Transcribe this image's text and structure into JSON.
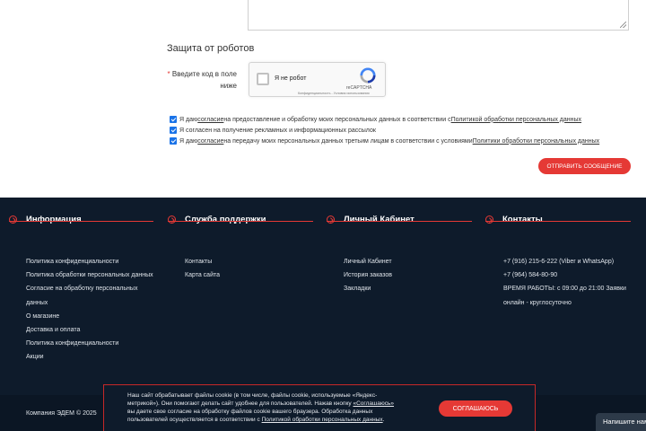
{
  "form": {
    "section_title": "Защита от роботов",
    "captcha_required_mark": "*",
    "captcha_label": "Введите код в поле ниже",
    "recaptcha": {
      "checkbox_label": "Я не робот",
      "brand": "reCAPTCHA",
      "terms": "Конфиденциальность - Условия использования"
    },
    "consents": [
      {
        "checked": true,
        "text_before": "Я даю ",
        "link1": "согласие",
        "text_middle": " на предоставление и обработку моих персональных данных в соответствии с ",
        "link2": "Политикой обработки персональных данных"
      },
      {
        "checked": true,
        "text": "Я согласен на получение рекламных и информационных рассылок"
      },
      {
        "checked": true,
        "text_before": "Я даю ",
        "link1": "согласие",
        "text_middle": " на передачу моих персональных данных третьим лицам в соответствии с условиями ",
        "link2": "Политики обработки персональных данных"
      }
    ],
    "submit_label": "ОТПРАВИТЬ СООБЩЕНИЕ"
  },
  "footer": {
    "columns": [
      {
        "title": "Информация",
        "links": [
          "Политика конфиденциальности",
          "Политика обработки персональных данных",
          "Согласие на обработку персональных",
          "данных",
          "О магазине",
          "Доставка и оплата",
          "Политика конфиденциальности",
          "Акции"
        ]
      },
      {
        "title": "Служба поддержки",
        "links": [
          "Контакты",
          "Карта сайта"
        ]
      },
      {
        "title": "Личный Кабинет",
        "links": [
          "Личный Кабинет",
          "История заказов",
          "Закладки"
        ]
      },
      {
        "title": "Контакты",
        "links": [
          "+7 (916) 215-6-222 (Viber и WhatsApp)",
          "+7 (964) 584-80-90",
          "ВРЕМЯ РАБОТЫ: с 09:00 до 21:00 Заявки",
          "онлайн - круглосуточно"
        ]
      }
    ],
    "copyright": "Компания ЭДЕМ © 2025"
  },
  "cookie": {
    "line1": "Наш сайт обрабатывает файлы cookie (в том числе, файлы cookie, используемые «Яндекс-",
    "line2_before": "метрикой»). Они помогают делать сайт удобнее для пользователей. Нажав кнопку ",
    "line2_link": "«Соглашаюсь»",
    "line3": "вы даете свое согласие на обработку файлов cookie вашего браузера. Обработка данных",
    "line4_before": "пользователей осуществляется в соответствии с ",
    "line4_link": "Политикой обработки персональных данных",
    "line4_after": ".",
    "button": "СОГЛАШАЮСЬ"
  },
  "chat": {
    "label": "Напишите нам"
  },
  "colors": {
    "accent": "#e53935",
    "footer_bg": "#0e1b2b",
    "checkbox": "#1a73e8"
  }
}
